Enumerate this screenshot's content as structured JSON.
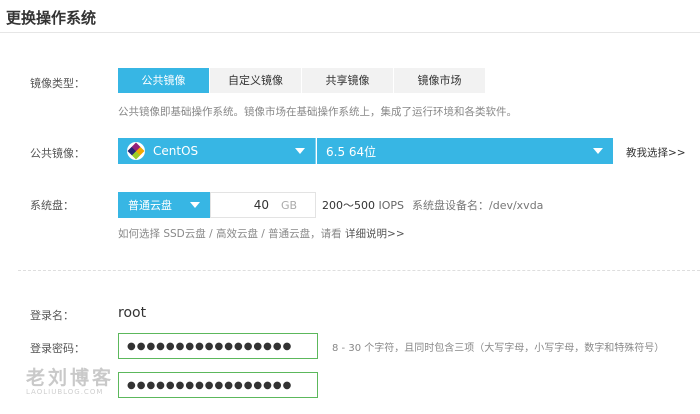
{
  "page": {
    "title": "更换操作系统"
  },
  "image_type": {
    "label": "镜像类型：",
    "tabs": [
      {
        "label": "公共镜像",
        "active": true
      },
      {
        "label": "自定义镜像",
        "active": false
      },
      {
        "label": "共享镜像",
        "active": false
      },
      {
        "label": "镜像市场",
        "active": false
      }
    ],
    "hint": "公共镜像即基础操作系统。镜像市场在基础操作系统上，集成了运行环境和各类软件。"
  },
  "public_image": {
    "label": "公共镜像：",
    "os": "CentOS",
    "version": "6.5 64位",
    "help_link": "教我选择>>"
  },
  "system_disk": {
    "label": "系统盘：",
    "type": "普通云盘",
    "size": "40",
    "unit": "GB",
    "iops_range": "200～500",
    "iops_unit": "IOPS",
    "device_label": "系统盘设备名：/dev/xvda",
    "hint_prefix": "如何选择 SSD云盘 / 高效云盘 / 普通云盘，请看",
    "hint_link": "详细说明>>"
  },
  "login": {
    "name_label": "登录名：",
    "name_value": "root",
    "password_label": "登录密码：",
    "password_value": "●●●●●●●●●●●●●●●●●",
    "confirm_value": "●●●●●●●●●●●●●●●●●",
    "password_hint": "8 - 30 个字符，且同时包含三项（大写字母，小写字母，数字和特殊符号）"
  },
  "watermark": {
    "text_cn": "老刘博客",
    "text_en": "LAOLIUBLOG.COM"
  },
  "colors": {
    "accent": "#37b6e4",
    "valid_border": "#5cb85c",
    "tab_inactive": "#f2f2f2"
  }
}
